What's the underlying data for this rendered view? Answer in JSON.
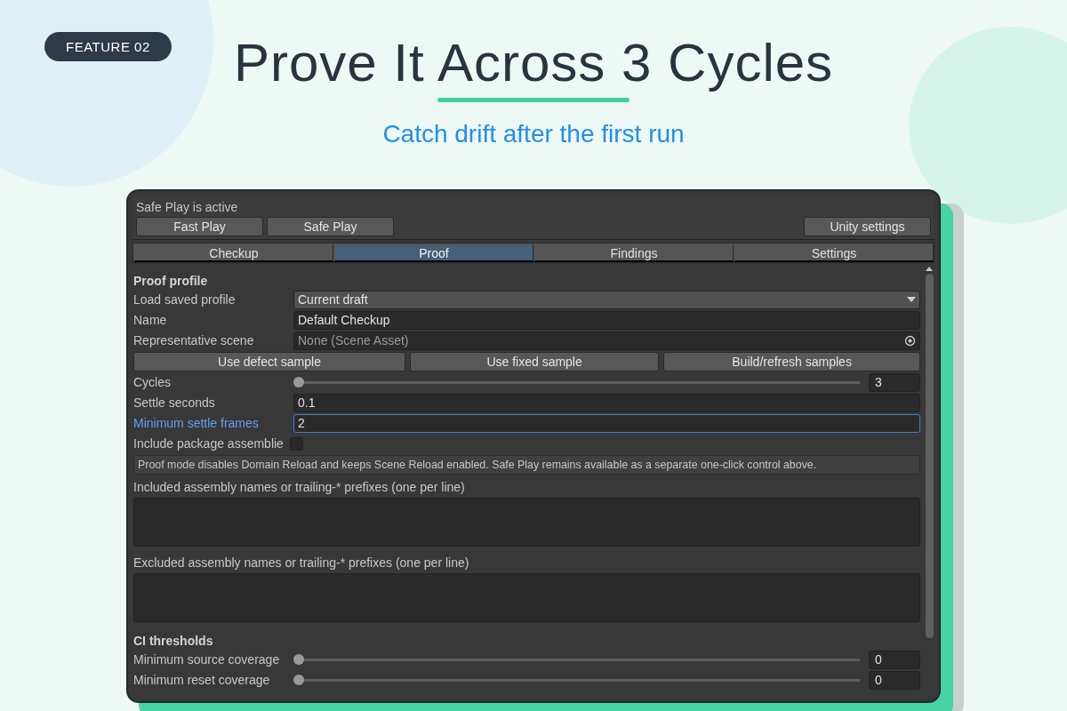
{
  "badge": "FEATURE 02",
  "title": "Prove It Across 3 Cycles",
  "subtitle": "Catch drift after the first run",
  "window": {
    "status": "Safe Play is active",
    "left_buttons": [
      "Fast Play",
      "Safe Play"
    ],
    "right_button": "Unity settings",
    "tabs": [
      {
        "label": "Checkup",
        "selected": false
      },
      {
        "label": "Proof",
        "selected": true
      },
      {
        "label": "Findings",
        "selected": false
      },
      {
        "label": "Settings",
        "selected": false
      }
    ],
    "rows": [
      {
        "kind": "header",
        "text": "Proof profile"
      },
      {
        "kind": "dropdown",
        "label": "Load saved profile",
        "value": "Current draft"
      },
      {
        "kind": "text",
        "label": "Name",
        "value": "Default Checkup",
        "focused": false
      },
      {
        "kind": "object",
        "label": "Representative scene",
        "placeholder": "None (Scene Asset)"
      },
      {
        "kind": "buttons",
        "buttons": [
          "Use defect sample",
          "Use fixed sample",
          "Build/refresh samples"
        ]
      },
      {
        "kind": "slider",
        "label": "Cycles",
        "level": 0,
        "value": "3"
      },
      {
        "kind": "text",
        "label": "Settle seconds",
        "value": "0.1",
        "focused": false
      },
      {
        "kind": "text",
        "label": "Minimum settle frames",
        "value": "2",
        "focused": true
      },
      {
        "kind": "checkbox",
        "label": "Include package assemblie",
        "checked": false
      },
      {
        "kind": "note",
        "text": "Proof mode disables Domain Reload and keeps Scene Reload enabled. Safe Play remains available as a separate one-click control above."
      },
      {
        "kind": "label",
        "text": "Included assembly names or trailing-* prefixes (one per line)"
      },
      {
        "kind": "textarea"
      },
      {
        "kind": "label",
        "text": "Excluded assembly names or trailing-* prefixes (one per line)"
      },
      {
        "kind": "textarea"
      },
      {
        "kind": "header",
        "text": "CI thresholds"
      },
      {
        "kind": "slider",
        "label": "Minimum source coverage",
        "level": 0,
        "value": "0"
      },
      {
        "kind": "slider",
        "label": "Minimum reset coverage",
        "level": 0,
        "value": "0"
      }
    ]
  }
}
